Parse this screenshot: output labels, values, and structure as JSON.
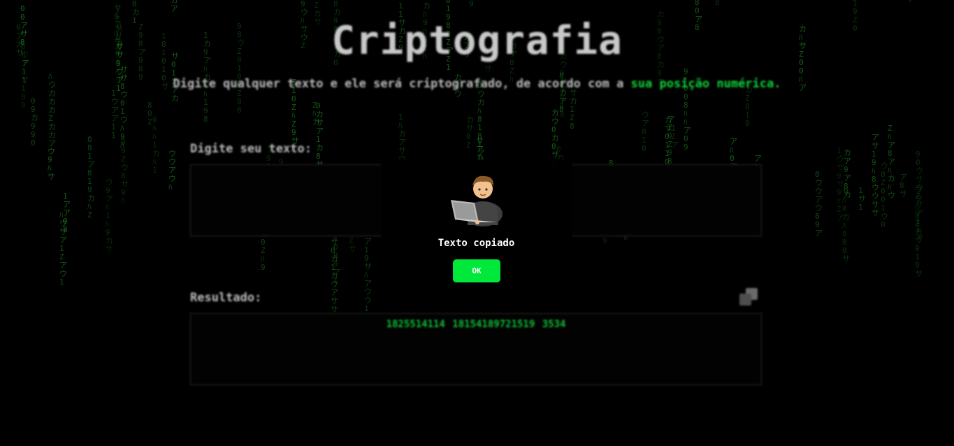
{
  "header": {
    "title": "Criptografia",
    "subtitle_plain": "Digite qualquer texto e ele será criptografado, de acordo com a ",
    "subtitle_highlight": "sua posição numérica."
  },
  "input": {
    "label": "Digite seu texto:",
    "value": ""
  },
  "result": {
    "label": "Resultado:",
    "value": "1825514114 18154189721519 3534",
    "copy_icon": "copy-icon"
  },
  "modal": {
    "icon": "technologist-emoji",
    "message": "Texto copiado",
    "ok_label": "OK"
  },
  "colors": {
    "background": "#000000",
    "accent": "#0fd63a",
    "button": "#00e83a",
    "rain": "#1f8a22"
  }
}
